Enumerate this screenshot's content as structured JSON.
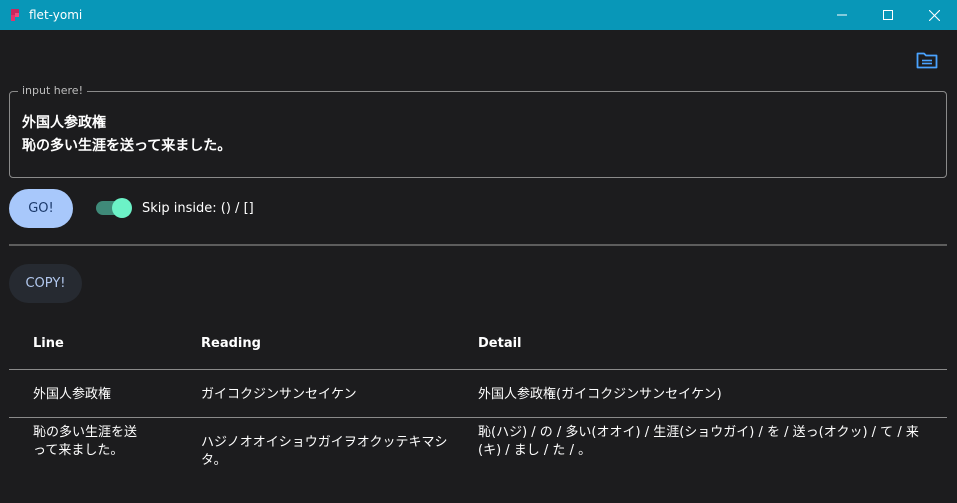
{
  "window": {
    "title": "flet-yomi",
    "minimize_glyph": "—",
    "maximize_glyph": "☐",
    "close_glyph": "✕"
  },
  "input": {
    "label": "input here!",
    "lines": [
      "外国人参政権",
      "恥の多い生涯を送って来ました。"
    ]
  },
  "controls": {
    "go_label": "GO!",
    "switch_on": true,
    "switch_label": "Skip inside: () / []",
    "copy_label": "COPY!"
  },
  "table": {
    "headers": [
      "Line",
      "Reading",
      "Detail"
    ],
    "rows": [
      {
        "line": "外国人参政権",
        "reading": "ガイコクジンサンセイケン",
        "detail": "外国人参政権(ガイコクジンサンセイケン)"
      },
      {
        "line": "恥の多い生涯を送って来ました。",
        "reading": "ハジノオオイショウガイヲオクッテキマシタ。",
        "detail": "恥(ハジ) / の / 多い(オオイ) / 生涯(ショウガイ) / を / 送っ(オクッ) / て / 来(キ) / まし / た / 。"
      }
    ]
  },
  "colors": {
    "titlebar": "#0897b8",
    "background": "#1c1c1e",
    "go_button": "#a8c8fb",
    "switch_track": "#3f8a79",
    "switch_thumb": "#6cf2c7",
    "folder_icon": "#4aa3ff"
  },
  "icons": {
    "app": "flet-logo-icon",
    "folder": "folder-open-icon"
  }
}
